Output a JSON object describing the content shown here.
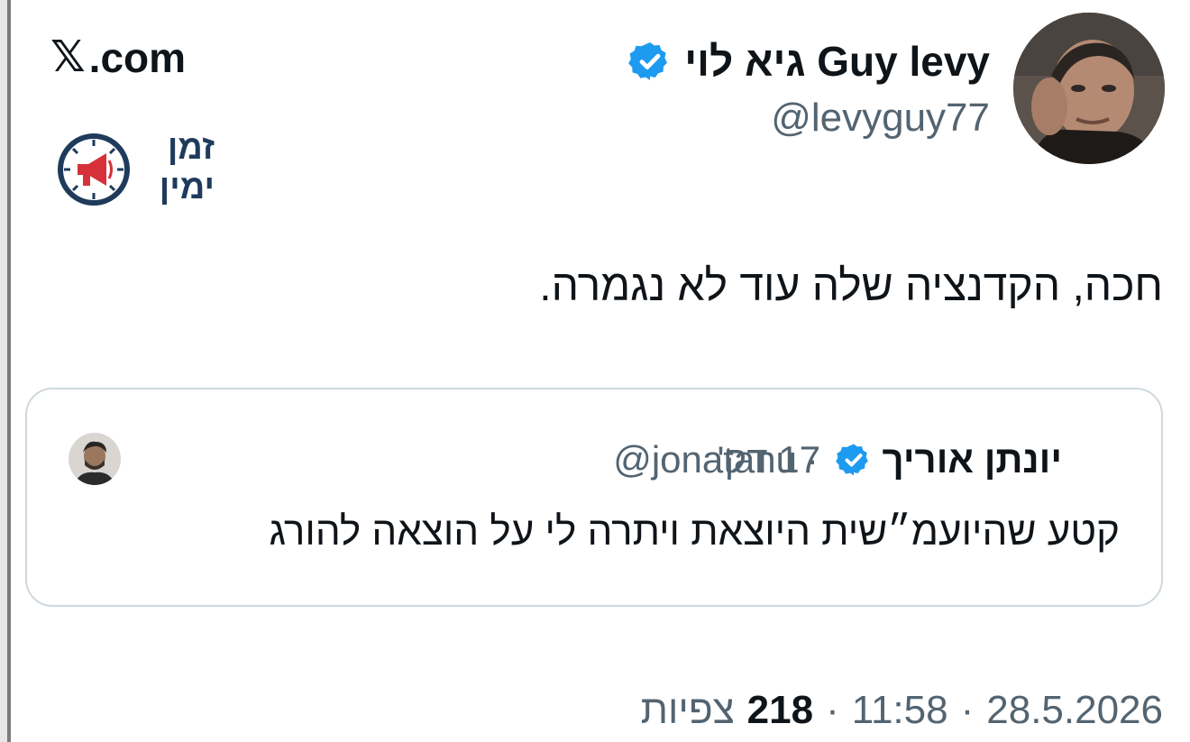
{
  "author": {
    "display_name": "גיא לוי Guy levy",
    "handle": "@levyguy77",
    "verified": true
  },
  "brand": {
    "x_glyph": "𝕏",
    "site": ".com",
    "logo_lines": [
      "זמן",
      "ימין"
    ]
  },
  "tweet": {
    "text": "חכה, הקדנציה שלה עוד לא נגמרה."
  },
  "quoted_tweet": {
    "display_name": "יונתן אוריך",
    "handle": "@jonatanu",
    "separator": "·",
    "time": "17 דק'",
    "text": "קטע שהיועמ״שית היוצאת ויתרה לי על הוצאה להורג",
    "verified": true
  },
  "meta": {
    "date": "28.5.2026",
    "time": "11:58",
    "views_count": "218",
    "views_label": "צפיות",
    "dot": "·"
  },
  "colors": {
    "verified_blue": "#1d9bf0",
    "secondary_text": "#536471",
    "brand_navy": "#1f3b5c",
    "brand_red": "#d6313a"
  }
}
